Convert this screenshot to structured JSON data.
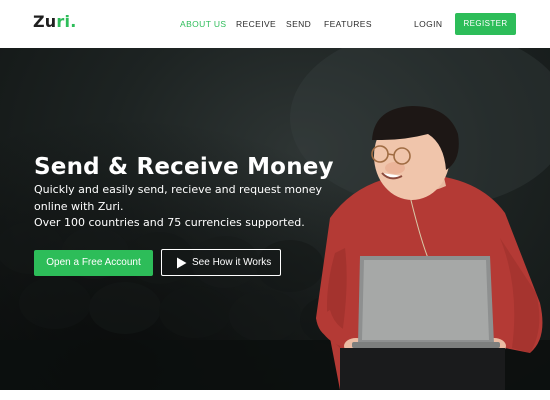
{
  "nav": {
    "logo": {
      "main": "Zu",
      "accent": "ri",
      "dot": "."
    },
    "links": [
      "ABOUT US",
      "RECEIVE",
      "SEND",
      "FEATURES"
    ],
    "login": "LOGIN",
    "register": "REGISTER"
  },
  "hero": {
    "title": "Send & Receive Money",
    "subtitle_lines": [
      "Quickly and easily send, recieve and request money",
      "online with Zuri.",
      "Over 100 countries and 75 currencies supported."
    ],
    "primary_cta": "Open a Free Account",
    "secondary_cta": "See How it Works"
  },
  "icons": {
    "secondary_cta_icon": "play-icon"
  },
  "colors": {
    "accent": "#2dbd59",
    "hero_dark": "#1d2322",
    "sweater": "#b43a35"
  }
}
